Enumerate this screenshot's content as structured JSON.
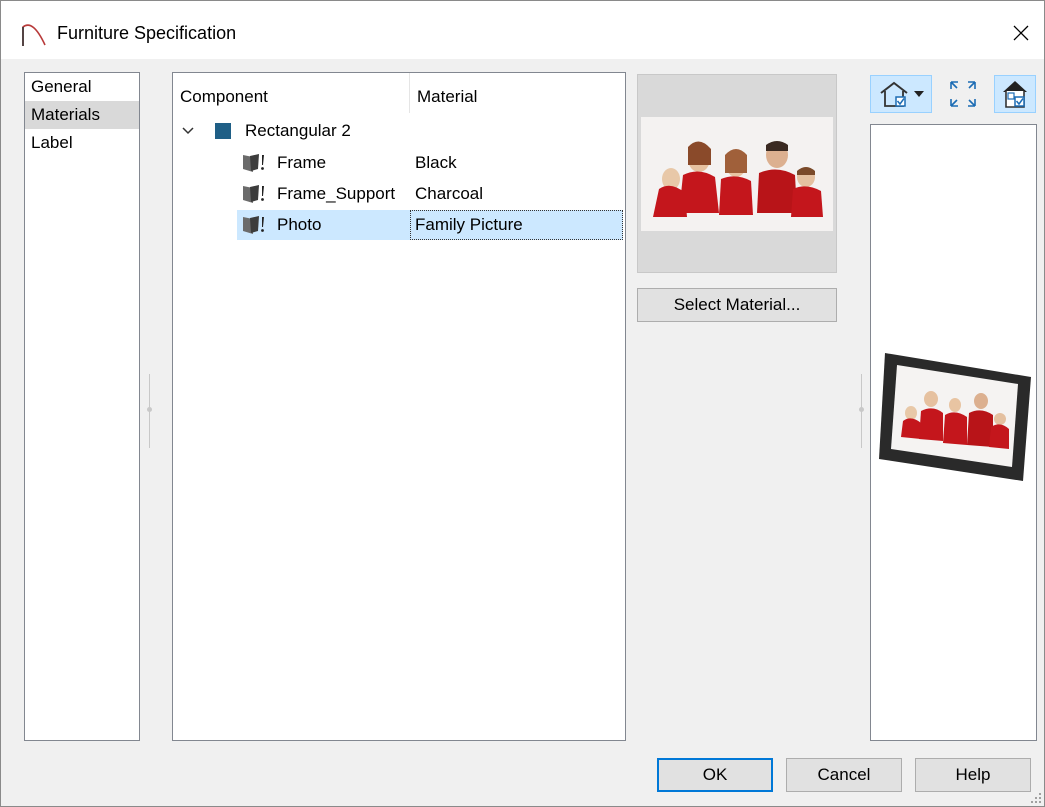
{
  "window": {
    "title": "Furniture Specification"
  },
  "nav": {
    "items": [
      "General",
      "Materials",
      "Label"
    ],
    "selected": "Materials"
  },
  "tree": {
    "columns": {
      "component": "Component",
      "material": "Material"
    },
    "root": {
      "label": "Rectangular 2",
      "color": "#1f5f86"
    },
    "rows": [
      {
        "component": "Frame",
        "material": "Black"
      },
      {
        "component": "Frame_Support",
        "material": "Charcoal"
      },
      {
        "component": "Photo",
        "material": "Family Picture"
      }
    ],
    "selected_row": "Photo"
  },
  "preview": {
    "select_label": "Select Material..."
  },
  "toolbar": {
    "icons": [
      "house-view-icon",
      "dropdown-arrow-icon",
      "fit-view-icon",
      "material-overlay-icon"
    ]
  },
  "buttons": {
    "ok": "OK",
    "cancel": "Cancel",
    "help": "Help"
  },
  "colors": {
    "selection": "#cce8ff",
    "accent": "#0078d7"
  }
}
